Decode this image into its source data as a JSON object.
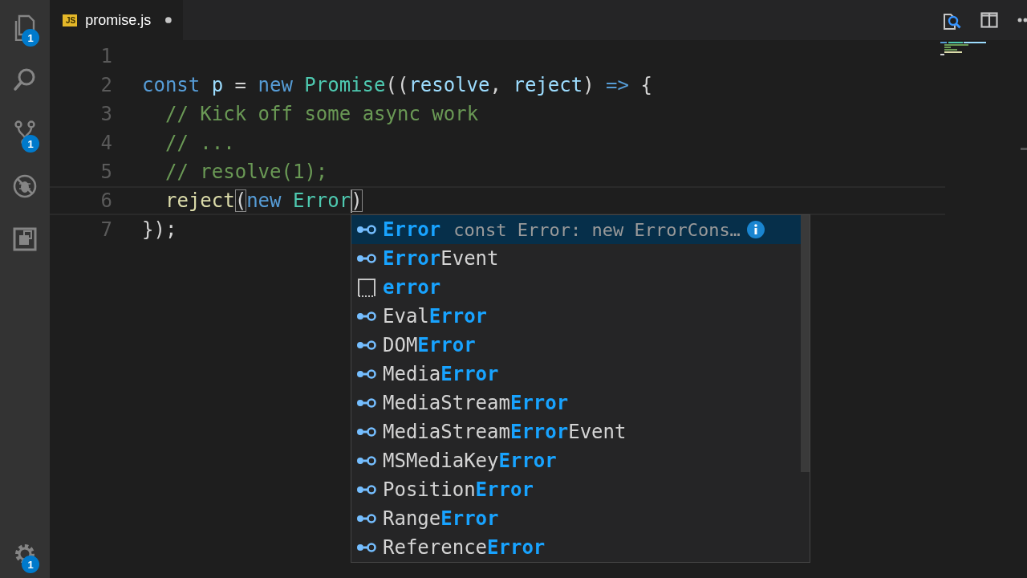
{
  "activity_bar": {
    "items": [
      {
        "kind": "files",
        "badge": "1"
      },
      {
        "kind": "search"
      },
      {
        "kind": "source_control",
        "badge": "1"
      },
      {
        "kind": "debug"
      },
      {
        "kind": "extensions"
      }
    ],
    "settings": {
      "badge": "1"
    }
  },
  "tab": {
    "icon": "JS",
    "label": "promise.js",
    "modified": true
  },
  "lines": [
    {
      "number": "1"
    },
    {
      "number": "2",
      "tokens": [
        {
          "text": "const",
          "kind": "keyword"
        },
        {
          "text": " p",
          "kind": "variable"
        },
        {
          "text": " = ",
          "kind": "plain"
        },
        {
          "text": "new",
          "kind": "keyword"
        },
        {
          "text": " Promise",
          "kind": "class"
        },
        {
          "text": "((",
          "kind": "plain"
        },
        {
          "text": "resolve",
          "kind": "variable"
        },
        {
          "text": ", ",
          "kind": "plain"
        },
        {
          "text": "reject",
          "kind": "variable"
        },
        {
          "text": ") ",
          "kind": "plain"
        },
        {
          "text": "=>",
          "kind": "keyword"
        },
        {
          "text": " {",
          "kind": "plain"
        }
      ]
    },
    {
      "number": "3",
      "indent": true,
      "tokens": [
        {
          "text": "// Kick off some async work",
          "kind": "comment"
        }
      ]
    },
    {
      "number": "4",
      "indent": true,
      "tokens": [
        {
          "text": "// ...",
          "kind": "comment"
        }
      ]
    },
    {
      "number": "5",
      "indent": true,
      "tokens": [
        {
          "text": "// resolve(1);",
          "kind": "comment"
        }
      ]
    },
    {
      "number": "6",
      "indent": true,
      "current": true,
      "tokens": [
        {
          "text": "reject",
          "kind": "function"
        },
        {
          "text": "(",
          "kind": "plain",
          "bracket_match": true
        },
        {
          "text": "new",
          "kind": "keyword"
        },
        {
          "text": " Error",
          "kind": "class"
        },
        {
          "text": ")",
          "kind": "plain",
          "bracket_match": true
        }
      ]
    },
    {
      "number": "7",
      "tokens": [
        {
          "text": "});",
          "kind": "plain"
        }
      ]
    }
  ],
  "suggestions": [
    {
      "kind": "class",
      "selected": true,
      "parts": [
        {
          "text": "Error",
          "match": true
        }
      ],
      "detail": "const Error: new ErrorCons…"
    },
    {
      "kind": "class",
      "selected": false,
      "parts": [
        {
          "text": "Error",
          "match": true
        },
        {
          "text": "Event",
          "match": false
        }
      ]
    },
    {
      "kind": "text",
      "selected": false,
      "parts": [
        {
          "text": "error",
          "match": true
        }
      ]
    },
    {
      "kind": "class",
      "selected": false,
      "parts": [
        {
          "text": "Eval",
          "match": false
        },
        {
          "text": "Error",
          "match": true
        }
      ]
    },
    {
      "kind": "class",
      "selected": false,
      "parts": [
        {
          "text": "DOM",
          "match": false
        },
        {
          "text": "Error",
          "match": true
        }
      ]
    },
    {
      "kind": "class",
      "selected": false,
      "parts": [
        {
          "text": "Media",
          "match": false
        },
        {
          "text": "Error",
          "match": true
        }
      ]
    },
    {
      "kind": "class",
      "selected": false,
      "parts": [
        {
          "text": "MediaStream",
          "match": false
        },
        {
          "text": "Error",
          "match": true
        }
      ]
    },
    {
      "kind": "class",
      "selected": false,
      "parts": [
        {
          "text": "MediaStream",
          "match": false
        },
        {
          "text": "Error",
          "match": true
        },
        {
          "text": "Event",
          "match": false
        }
      ]
    },
    {
      "kind": "class",
      "selected": false,
      "parts": [
        {
          "text": "MSMediaKey",
          "match": false
        },
        {
          "text": "Error",
          "match": true
        }
      ]
    },
    {
      "kind": "class",
      "selected": false,
      "parts": [
        {
          "text": "Position",
          "match": false
        },
        {
          "text": "Error",
          "match": true
        }
      ]
    },
    {
      "kind": "class",
      "selected": false,
      "parts": [
        {
          "text": "Range",
          "match": false
        },
        {
          "text": "Error",
          "match": true
        }
      ]
    },
    {
      "kind": "class",
      "selected": false,
      "parts": [
        {
          "text": "Reference",
          "match": false
        },
        {
          "text": "Error",
          "match": true
        }
      ]
    }
  ]
}
